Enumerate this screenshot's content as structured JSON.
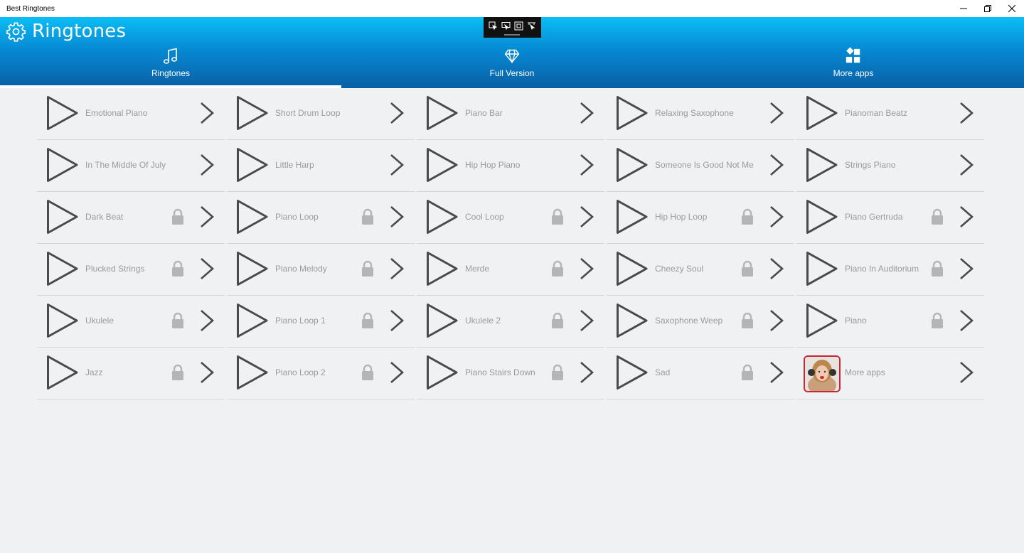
{
  "window": {
    "title": "Best Ringtones",
    "controls": [
      "minimize-icon",
      "restore-icon",
      "close-icon"
    ]
  },
  "header": {
    "brand_icon": "gear-icon",
    "title": "Ringtones"
  },
  "tabs": [
    {
      "label": "Ringtones",
      "icon": "music-note-icon",
      "active": true
    },
    {
      "label": "Full Version",
      "icon": "diamond-icon",
      "active": false
    },
    {
      "label": "More apps",
      "icon": "apps-grid-icon",
      "active": false
    }
  ],
  "colors": {
    "header_top": "#0bbdf5",
    "header_bottom": "#0a5fa5",
    "background": "#f0f1f3",
    "icon": "#4a4a4a",
    "lock": "#b5b5b5",
    "text": "#9a9a9a"
  },
  "ringtones": [
    {
      "name": "Emotional Piano",
      "locked": false
    },
    {
      "name": "Short Drum Loop",
      "locked": false
    },
    {
      "name": "Piano Bar",
      "locked": false
    },
    {
      "name": "Relaxing Saxophone",
      "locked": false
    },
    {
      "name": "Pianoman Beatz",
      "locked": false
    },
    {
      "name": "In The Middle Of July",
      "locked": false
    },
    {
      "name": "Little Harp",
      "locked": false
    },
    {
      "name": "Hip Hop Piano",
      "locked": false
    },
    {
      "name": "Someone Is Good Not Me",
      "locked": false
    },
    {
      "name": "Strings Piano",
      "locked": false
    },
    {
      "name": "Dark Beat",
      "locked": true
    },
    {
      "name": "Piano Loop",
      "locked": true
    },
    {
      "name": "Cool Loop",
      "locked": true
    },
    {
      "name": "Hip Hop Loop",
      "locked": true
    },
    {
      "name": "Piano Gertruda",
      "locked": true
    },
    {
      "name": "Plucked Strings",
      "locked": true
    },
    {
      "name": "Piano Melody",
      "locked": true
    },
    {
      "name": "Merde",
      "locked": true
    },
    {
      "name": "Cheezy Soul",
      "locked": true
    },
    {
      "name": "Piano In Auditorium",
      "locked": true
    },
    {
      "name": "Ukulele",
      "locked": true
    },
    {
      "name": "Piano Loop 1",
      "locked": true
    },
    {
      "name": "Ukulele 2",
      "locked": true
    },
    {
      "name": "Saxophone Weep",
      "locked": true
    },
    {
      "name": "Piano",
      "locked": true
    },
    {
      "name": "Jazz",
      "locked": true
    },
    {
      "name": "Piano Loop 2",
      "locked": true
    },
    {
      "name": "Piano Stairs Down",
      "locked": true
    },
    {
      "name": "Sad",
      "locked": true
    }
  ],
  "more_apps_tile": {
    "name": "More apps",
    "icon": "app-thumbnail-icon"
  }
}
